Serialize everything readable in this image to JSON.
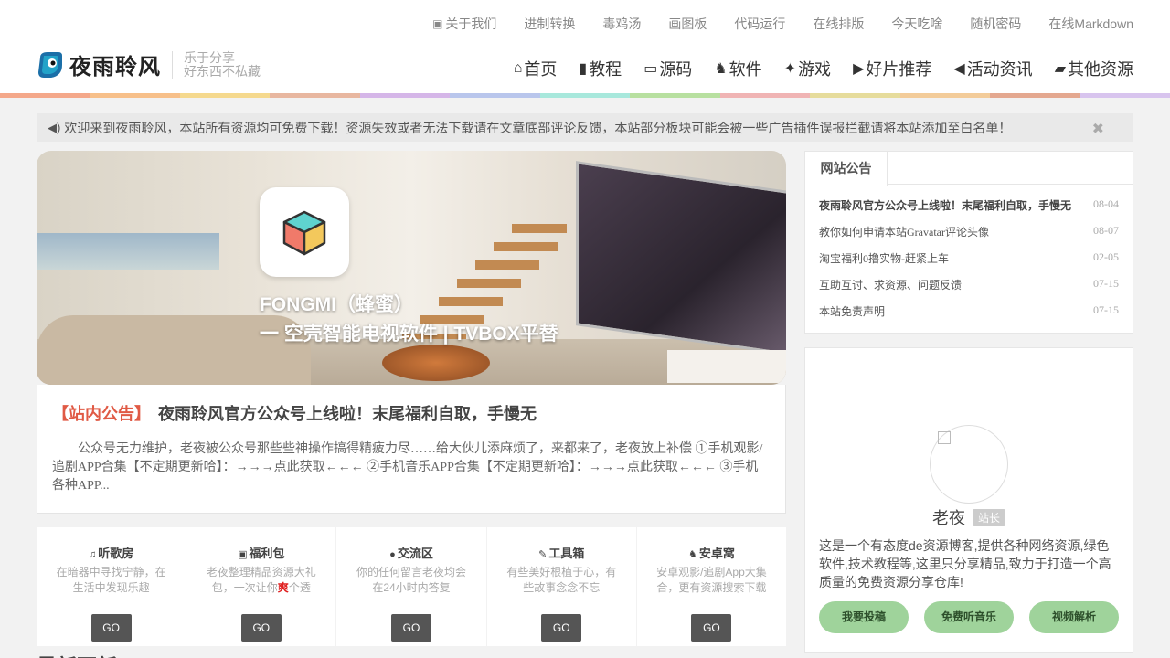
{
  "colors": {
    "accent_tag": "#e05a45",
    "button_dark": "#555555",
    "button_green": "#9fd39b",
    "rainbow": [
      "#f4a88a",
      "#f7c08a",
      "#f5d98e",
      "#e8b7a0",
      "#d5b6e8",
      "#b9c6ec",
      "#a8e8dc",
      "#b8e0a0",
      "#f0b4b4",
      "#e6dc9c",
      "#f3cc9a",
      "#e4a890",
      "#d8c4ee"
    ]
  },
  "top_links": [
    {
      "label": "关于我们",
      "icon": "info-icon"
    },
    {
      "label": "进制转换"
    },
    {
      "label": "毒鸡汤"
    },
    {
      "label": "画图板"
    },
    {
      "label": "代码运行"
    },
    {
      "label": "在线排版"
    },
    {
      "label": "今天吃啥"
    },
    {
      "label": "随机密码"
    },
    {
      "label": "在线Markdown"
    }
  ],
  "brand": {
    "name": "夜雨聆风",
    "slogan_line1": "乐于分享",
    "slogan_line2": "好东西不私藏"
  },
  "main_nav": [
    {
      "label": "首页",
      "icon": "home-icon",
      "glyph": "⌂"
    },
    {
      "label": "教程",
      "icon": "bookmark-icon",
      "glyph": "▮"
    },
    {
      "label": "源码",
      "icon": "code-file-icon",
      "glyph": "▭"
    },
    {
      "label": "软件",
      "icon": "android-icon",
      "glyph": "♞"
    },
    {
      "label": "游戏",
      "icon": "gamepad-icon",
      "glyph": "✦"
    },
    {
      "label": "好片推荐",
      "icon": "play-circle-icon",
      "glyph": "▶"
    },
    {
      "label": "活动资讯",
      "icon": "megaphone-icon",
      "glyph": "◀"
    },
    {
      "label": "其他资源",
      "icon": "folder-open-icon",
      "glyph": "▰"
    }
  ],
  "notice": {
    "text": "欢迎来到夜雨聆风，本站所有资源均可免费下载！资源失效或者无法下载请在文章底部评论反馈，本站部分板块可能会被一些广告插件误报拦截请将本站添加至白名单！",
    "close_glyph": "✖"
  },
  "banner": {
    "title": "FONGMI（蜂蜜）",
    "subtitle": "一 空壳智能电视软件 | TVBOX平替"
  },
  "featured_post": {
    "tag": "【站内公告】",
    "title": "夜雨聆风官方公众号上线啦！末尾福利自取，手慢无",
    "excerpt": "公众号无力维护，老夜被公众号那些些神操作搞得精疲力尽……给大伙儿添麻烦了，来都来了，老夜放上补偿 ①手机观影/追剧APP合集【不定期更新哈】：→→→点此获取←←← ②手机音乐APP合集【不定期更新哈】：→→→点此获取←←← ③手机各种APP..."
  },
  "cards": [
    {
      "title": "听歌房",
      "icon": "music-icon",
      "glyph": "♫",
      "desc": "在暗器中寻找宁静，在生活中发现乐趣",
      "btn": "GO"
    },
    {
      "title": "福利包",
      "icon": "cart-icon",
      "glyph": "▣",
      "desc_pre": "老夜整理精品资源大礼包，一次让你",
      "desc_em": "爽",
      "desc_post": "个透",
      "btn": "GO"
    },
    {
      "title": "交流区",
      "icon": "comments-icon",
      "glyph": "●",
      "desc": "你的任何留言老夜均会在24小时内答复",
      "btn": "GO"
    },
    {
      "title": "工具箱",
      "icon": "wrench-icon",
      "glyph": "✎",
      "desc": "有些美好根植于心，有些故事念念不忘",
      "btn": "GO"
    },
    {
      "title": "安卓窝",
      "icon": "android-icon",
      "glyph": "♞",
      "desc": "安卓观影/追剧App大集合，更有资源搜索下载",
      "btn": "GO"
    }
  ],
  "latest_heading": "最新更新",
  "announcements": {
    "tab": "网站公告",
    "items": [
      {
        "title": "夜雨聆风官方公众号上线啦！末尾福利自取，手慢无",
        "date": "08-04"
      },
      {
        "title": "教你如何申请本站Gravatar评论头像",
        "date": "08-07"
      },
      {
        "title": "淘宝福利0撸实物-赶紧上车",
        "date": "02-05"
      },
      {
        "title": "互助互讨、求资源、问题反馈",
        "date": "07-15"
      },
      {
        "title": "本站免责声明",
        "date": "07-15"
      }
    ]
  },
  "profile": {
    "name": "老夜",
    "badge": "站长",
    "desc": "这是一个有态度de资源博客,提供各种网络资源,绿色软件,技术教程等,这里只分享精品,致力于打造一个高质量的免费资源分享仓库!",
    "buttons": [
      "我要投稿",
      "免费听音乐",
      "视频解析"
    ]
  }
}
